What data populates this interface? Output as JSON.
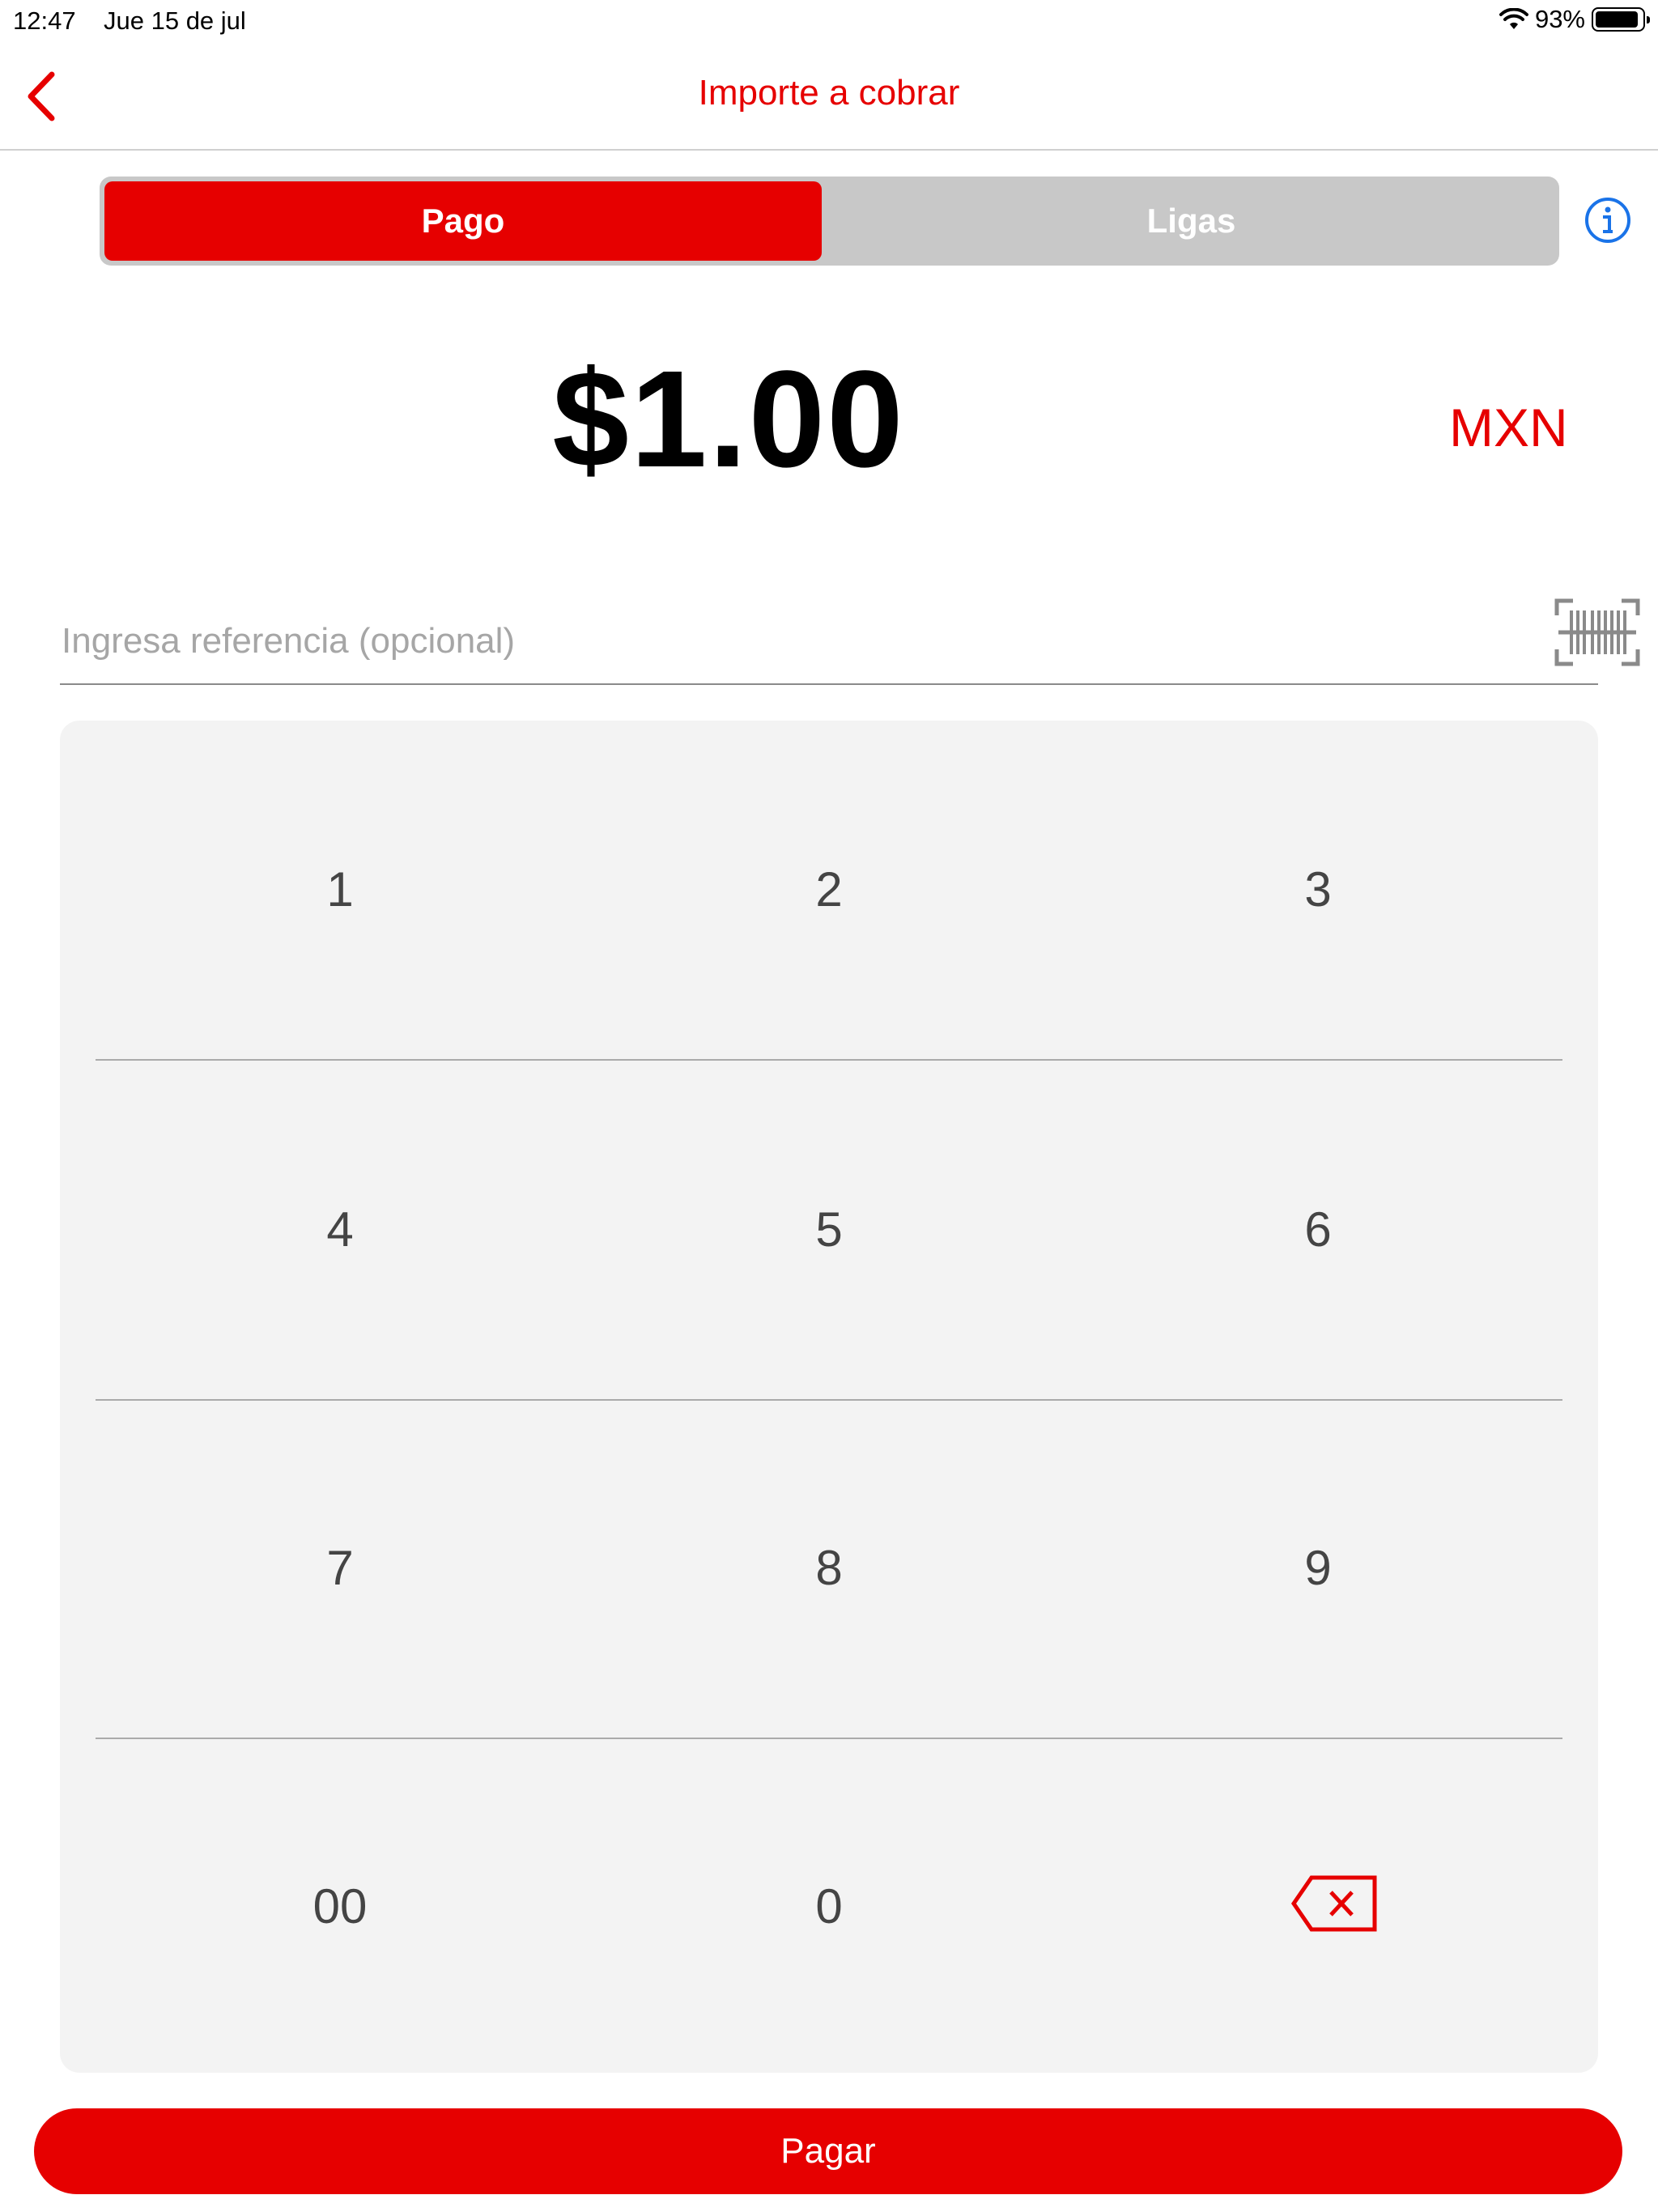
{
  "status_bar": {
    "time": "12:47",
    "date": "Jue 15 de jul",
    "battery": "93%",
    "battery_level": 0.93
  },
  "header": {
    "title": "Importe a cobrar",
    "back_icon": "chevron-left-icon"
  },
  "tabs": {
    "items": [
      {
        "label": "Pago",
        "active": true
      },
      {
        "label": "Ligas",
        "active": false
      }
    ],
    "info_icon": "info-icon"
  },
  "amount": {
    "value": "$1.00",
    "currency": "MXN"
  },
  "reference": {
    "placeholder": "Ingresa referencia (opcional)",
    "value": "",
    "scan_icon": "barcode-icon"
  },
  "keypad": {
    "rows": [
      [
        "1",
        "2",
        "3"
      ],
      [
        "4",
        "5",
        "6"
      ],
      [
        "7",
        "8",
        "9"
      ],
      [
        "00",
        "0",
        "backspace"
      ]
    ],
    "backspace_icon": "backspace-icon"
  },
  "actions": {
    "pay_label": "Pagar"
  },
  "colors": {
    "brand_red": "#e60000",
    "info_blue": "#1a73e8",
    "keypad_bg": "#f3f3f3"
  }
}
